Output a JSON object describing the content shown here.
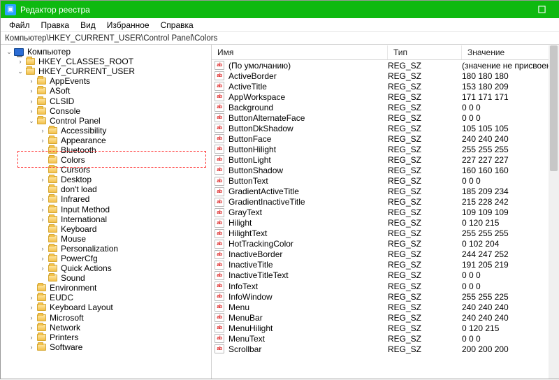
{
  "window": {
    "title": "Редактор реестра"
  },
  "menu": [
    "Файл",
    "Правка",
    "Вид",
    "Избранное",
    "Справка"
  ],
  "address": "Компьютер\\HKEY_CURRENT_USER\\Control Panel\\Colors",
  "tree": [
    {
      "depth": 1,
      "icon": "pc",
      "label": "Компьютер",
      "exp": "open"
    },
    {
      "depth": 2,
      "icon": "folder",
      "label": "HKEY_CLASSES_ROOT",
      "exp": "closed"
    },
    {
      "depth": 2,
      "icon": "folder",
      "label": "HKEY_CURRENT_USER",
      "exp": "open"
    },
    {
      "depth": 3,
      "icon": "folder",
      "label": "AppEvents",
      "exp": "closed"
    },
    {
      "depth": 3,
      "icon": "folder",
      "label": "ASoft",
      "exp": "closed"
    },
    {
      "depth": 3,
      "icon": "folder",
      "label": "CLSID",
      "exp": "closed"
    },
    {
      "depth": 3,
      "icon": "folder",
      "label": "Console",
      "exp": "closed"
    },
    {
      "depth": 3,
      "icon": "folder",
      "label": "Control Panel",
      "exp": "open"
    },
    {
      "depth": 4,
      "icon": "folder",
      "label": "Accessibility",
      "exp": "closed"
    },
    {
      "depth": 4,
      "icon": "folder",
      "label": "Appearance",
      "exp": "closed"
    },
    {
      "depth": 4,
      "icon": "folder",
      "label": "Bluetooth",
      "exp": "closed"
    },
    {
      "depth": 4,
      "icon": "folder",
      "label": "Colors",
      "exp": "none",
      "hl": true
    },
    {
      "depth": 4,
      "icon": "folder",
      "label": "Cursors",
      "exp": "none"
    },
    {
      "depth": 4,
      "icon": "folder",
      "label": "Desktop",
      "exp": "closed"
    },
    {
      "depth": 4,
      "icon": "folder",
      "label": "don't load",
      "exp": "none"
    },
    {
      "depth": 4,
      "icon": "folder",
      "label": "Infrared",
      "exp": "closed"
    },
    {
      "depth": 4,
      "icon": "folder",
      "label": "Input Method",
      "exp": "closed"
    },
    {
      "depth": 4,
      "icon": "folder",
      "label": "International",
      "exp": "closed"
    },
    {
      "depth": 4,
      "icon": "folder",
      "label": "Keyboard",
      "exp": "none"
    },
    {
      "depth": 4,
      "icon": "folder",
      "label": "Mouse",
      "exp": "none"
    },
    {
      "depth": 4,
      "icon": "folder",
      "label": "Personalization",
      "exp": "closed"
    },
    {
      "depth": 4,
      "icon": "folder",
      "label": "PowerCfg",
      "exp": "closed"
    },
    {
      "depth": 4,
      "icon": "folder",
      "label": "Quick Actions",
      "exp": "closed"
    },
    {
      "depth": 4,
      "icon": "folder",
      "label": "Sound",
      "exp": "none"
    },
    {
      "depth": 3,
      "icon": "folder",
      "label": "Environment",
      "exp": "none"
    },
    {
      "depth": 3,
      "icon": "folder",
      "label": "EUDC",
      "exp": "closed"
    },
    {
      "depth": 3,
      "icon": "folder",
      "label": "Keyboard Layout",
      "exp": "closed"
    },
    {
      "depth": 3,
      "icon": "folder",
      "label": "Microsoft",
      "exp": "closed"
    },
    {
      "depth": 3,
      "icon": "folder",
      "label": "Network",
      "exp": "closed"
    },
    {
      "depth": 3,
      "icon": "folder",
      "label": "Printers",
      "exp": "closed"
    },
    {
      "depth": 3,
      "icon": "folder",
      "label": "Software",
      "exp": "closed"
    }
  ],
  "columns": {
    "name": "Имя",
    "type": "Тип",
    "value": "Значение"
  },
  "values": [
    {
      "name": "(По умолчанию)",
      "type": "REG_SZ",
      "value": "(значение не присвоено)"
    },
    {
      "name": "ActiveBorder",
      "type": "REG_SZ",
      "value": "180 180 180"
    },
    {
      "name": "ActiveTitle",
      "type": "REG_SZ",
      "value": "153 180 209"
    },
    {
      "name": "AppWorkspace",
      "type": "REG_SZ",
      "value": "171 171 171"
    },
    {
      "name": "Background",
      "type": "REG_SZ",
      "value": "0 0 0"
    },
    {
      "name": "ButtonAlternateFace",
      "type": "REG_SZ",
      "value": "0 0 0"
    },
    {
      "name": "ButtonDkShadow",
      "type": "REG_SZ",
      "value": "105 105 105"
    },
    {
      "name": "ButtonFace",
      "type": "REG_SZ",
      "value": "240 240 240"
    },
    {
      "name": "ButtonHilight",
      "type": "REG_SZ",
      "value": "255 255 255"
    },
    {
      "name": "ButtonLight",
      "type": "REG_SZ",
      "value": "227 227 227"
    },
    {
      "name": "ButtonShadow",
      "type": "REG_SZ",
      "value": "160 160 160"
    },
    {
      "name": "ButtonText",
      "type": "REG_SZ",
      "value": "0 0 0"
    },
    {
      "name": "GradientActiveTitle",
      "type": "REG_SZ",
      "value": "185 209 234"
    },
    {
      "name": "GradientInactiveTitle",
      "type": "REG_SZ",
      "value": "215 228 242"
    },
    {
      "name": "GrayText",
      "type": "REG_SZ",
      "value": "109 109 109"
    },
    {
      "name": "Hilight",
      "type": "REG_SZ",
      "value": "0 120 215"
    },
    {
      "name": "HilightText",
      "type": "REG_SZ",
      "value": "255 255 255"
    },
    {
      "name": "HotTrackingColor",
      "type": "REG_SZ",
      "value": "0 102 204"
    },
    {
      "name": "InactiveBorder",
      "type": "REG_SZ",
      "value": "244 247 252"
    },
    {
      "name": "InactiveTitle",
      "type": "REG_SZ",
      "value": "191 205 219"
    },
    {
      "name": "InactiveTitleText",
      "type": "REG_SZ",
      "value": "0 0 0"
    },
    {
      "name": "InfoText",
      "type": "REG_SZ",
      "value": "0 0 0"
    },
    {
      "name": "InfoWindow",
      "type": "REG_SZ",
      "value": "255 255 225"
    },
    {
      "name": "Menu",
      "type": "REG_SZ",
      "value": "240 240 240"
    },
    {
      "name": "MenuBar",
      "type": "REG_SZ",
      "value": "240 240 240"
    },
    {
      "name": "MenuHilight",
      "type": "REG_SZ",
      "value": "0 120 215"
    },
    {
      "name": "MenuText",
      "type": "REG_SZ",
      "value": "0 0 0"
    },
    {
      "name": "Scrollbar",
      "type": "REG_SZ",
      "value": "200 200 200"
    }
  ],
  "icon_label": "ab"
}
